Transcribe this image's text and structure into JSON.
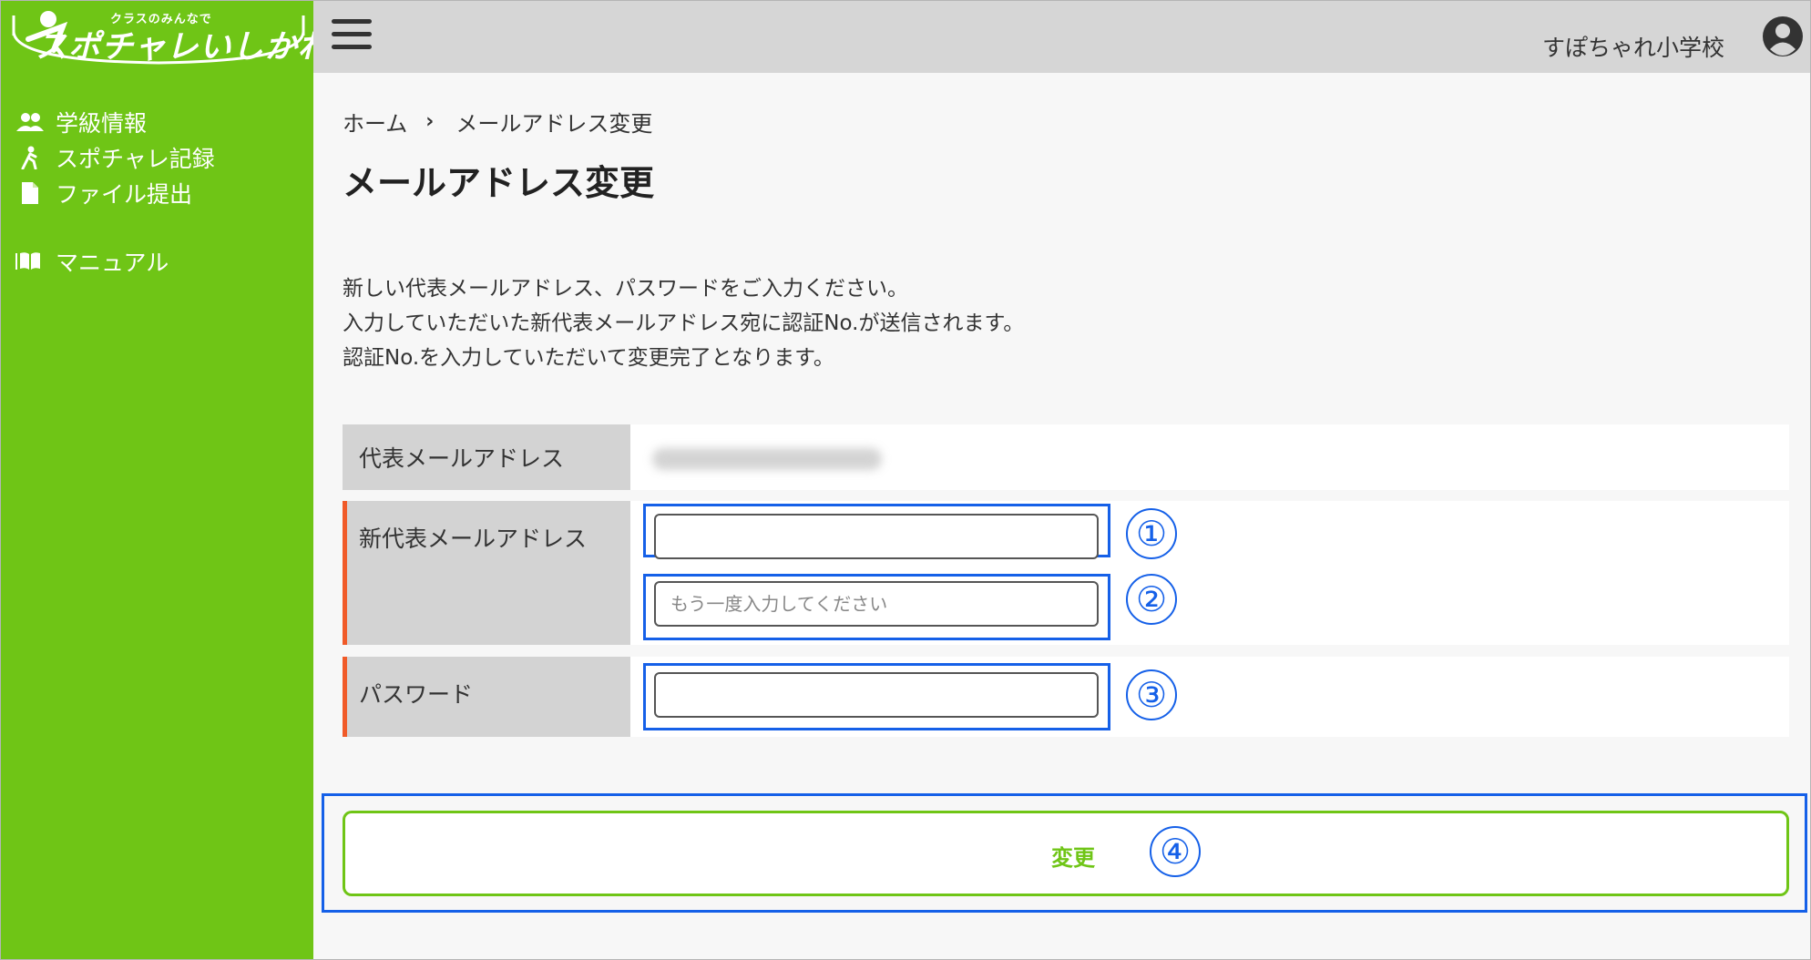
{
  "app": {
    "logo_small": "クラスのみんなで",
    "logo_main": "スポチャレいしかわ"
  },
  "sidebar": {
    "items": [
      {
        "label": "学級情報",
        "icon": "people-icon"
      },
      {
        "label": "スポチャレ記録",
        "icon": "running-icon"
      },
      {
        "label": "ファイル提出",
        "icon": "file-icon"
      }
    ],
    "manual": {
      "label": "マニュアル",
      "icon": "book-icon"
    }
  },
  "header": {
    "school_name": "すぽちゃれ小学校"
  },
  "breadcrumb": {
    "home": "ホーム",
    "separator": "›",
    "current": "メールアドレス変更"
  },
  "page": {
    "title": "メールアドレス変更",
    "description": [
      "新しい代表メールアドレス、パスワードをご入力ください。",
      "入力していただいた新代表メールアドレス宛に認証No.が送信されます。",
      "認証No.を入力していただいて変更完了となります。"
    ]
  },
  "form": {
    "current_email_label": "代表メールアドレス",
    "new_email_label": "新代表メールアドレス",
    "new_email_value": "",
    "confirm_placeholder": "もう一度入力してください",
    "password_label": "パスワード",
    "password_value": "",
    "submit_label": "変更"
  },
  "annotations": [
    "①",
    "②",
    "③",
    "④"
  ],
  "colors": {
    "sidebar": "#6fc516",
    "header": "#d6d6d6",
    "required_marker": "#f05a28",
    "highlight": "#1560e8"
  }
}
